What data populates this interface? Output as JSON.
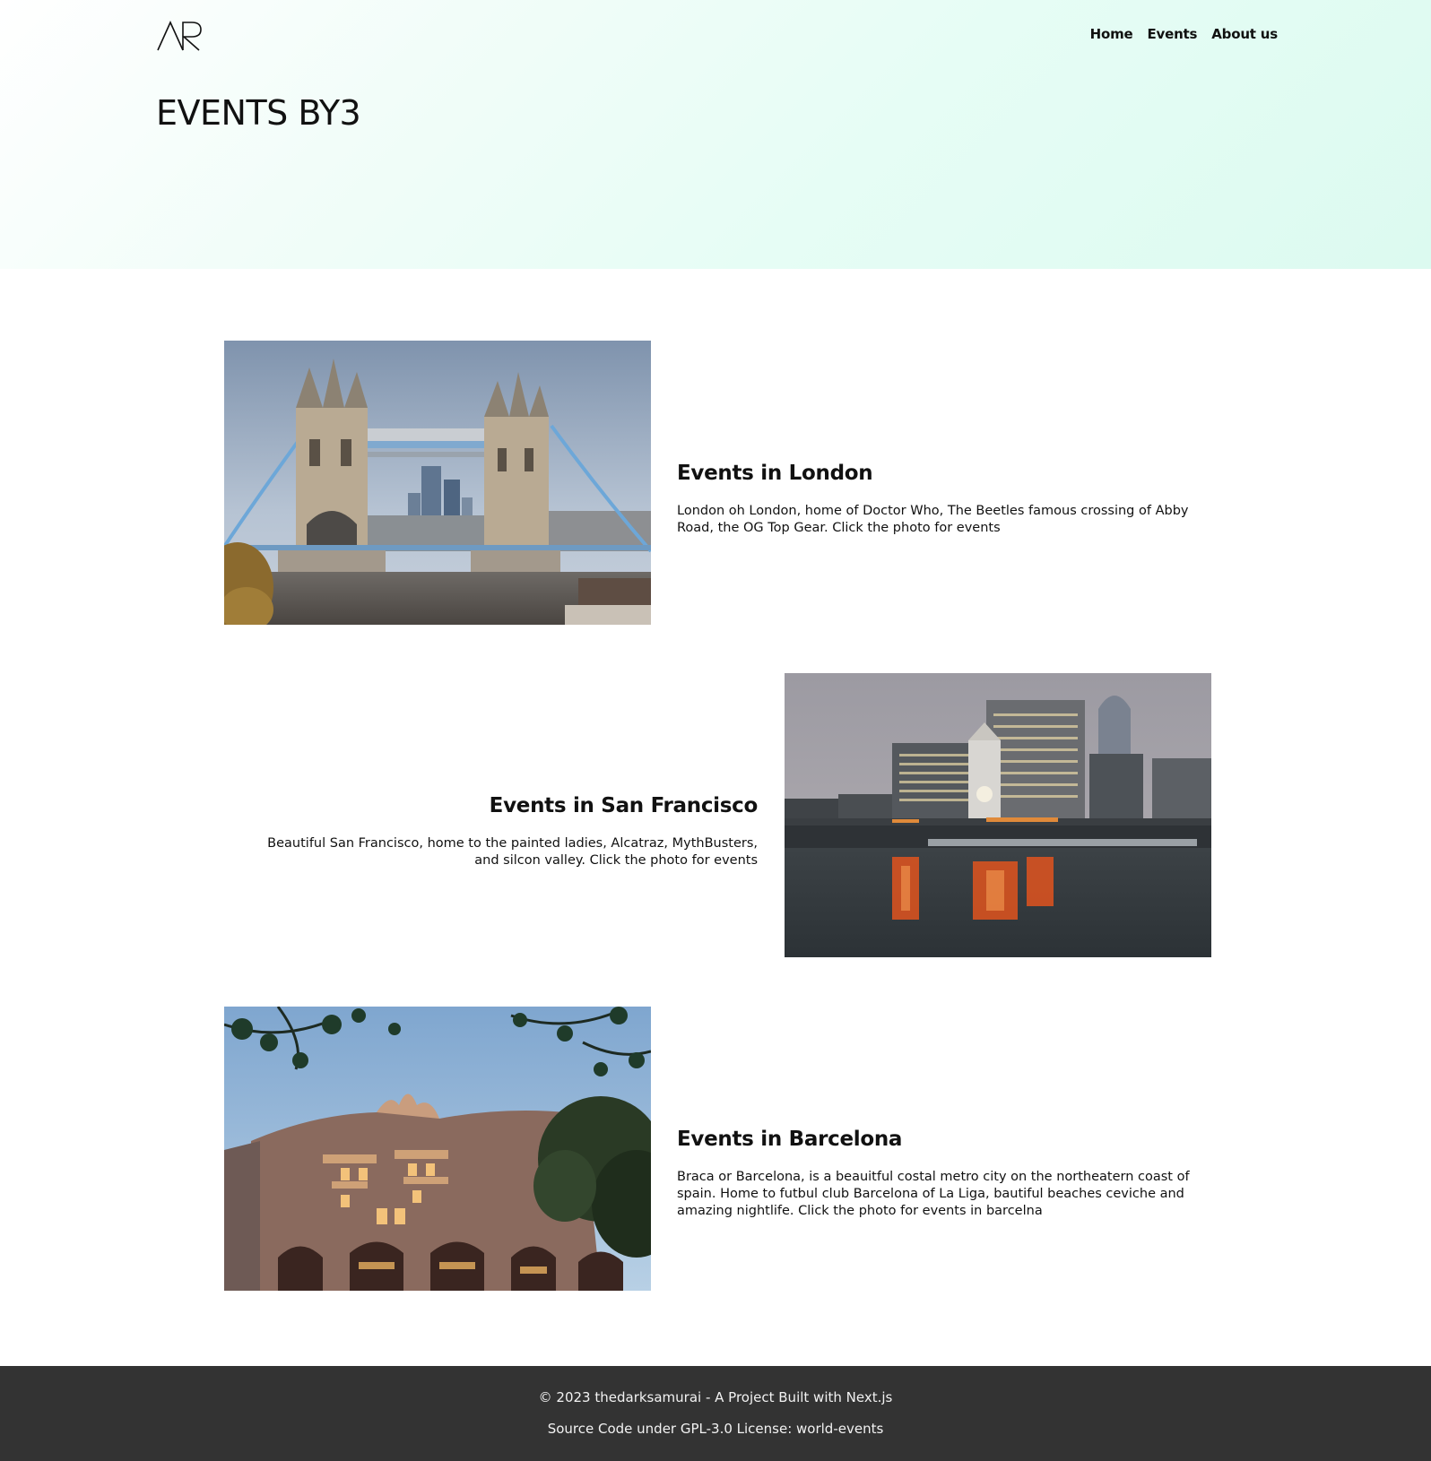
{
  "header": {
    "logo_text": "AR",
    "title": "EVENTS BY3",
    "nav": [
      {
        "label": "Home"
      },
      {
        "label": "Events"
      },
      {
        "label": "About us"
      }
    ]
  },
  "events": [
    {
      "title": "Events in London",
      "description": "London oh London, home of Doctor Who, The Beetles famous crossing of Abby Road, the OG Top Gear. Click the photo for events",
      "image": "tower-bridge-photo"
    },
    {
      "title": "Events in San Francisco",
      "description": "Beautiful San Francisco, home to the painted ladies, Alcatraz, MythBusters, and silcon valley. Click the photo for events",
      "image": "ferry-building-photo"
    },
    {
      "title": "Events in Barcelona",
      "description": "Braca or Barcelona, is a beauitful costal metro city on the northeatern coast of spain. Home to futbul club Barcelona of La Liga, bautiful beaches ceviche and amazing nightlife. Click the photo for events in barcelna",
      "image": "casa-batllo-photo"
    }
  ],
  "footer": {
    "copyright": "© 2023 thedarksamurai - A Project Built with Next.js",
    "license_prefix": "Source Code under GPL-3.0 License: ",
    "license_link": "world-events"
  },
  "colors": {
    "header_gradient_end": "#dcfaf0",
    "footer_bg": "#333333",
    "text": "#111111"
  }
}
